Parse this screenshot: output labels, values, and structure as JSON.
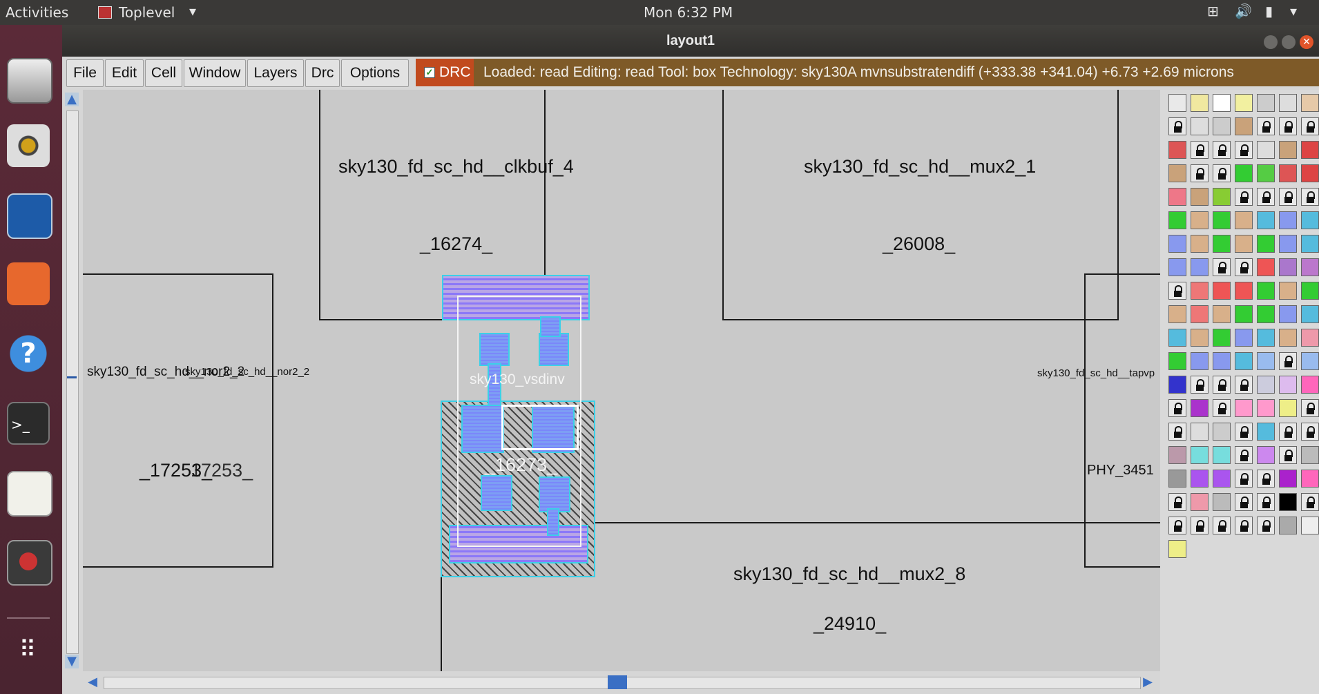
{
  "topbar": {
    "activities": "Activities",
    "app": "Toplevel",
    "clock": "Mon  6:32 PM"
  },
  "window": {
    "title": "layout1"
  },
  "menu": {
    "file": "File",
    "edit": "Edit",
    "cell": "Cell",
    "window": "Window",
    "layers": "Layers",
    "drc_menu": "Drc",
    "options": "Options",
    "drc_toggle": "DRC",
    "status": "Loaded: read  Editing: read  Tool: box   Technology: sky130A    mvnsubstratendiff    (+333.38 +341.04) +6.73 +2.69 microns"
  },
  "cells": {
    "clkbuf_name": "sky130_fd_sc_hd__clkbuf_4",
    "clkbuf_id": "_16274_",
    "mux21_name": "sky130_fd_sc_hd__mux2_1",
    "mux21_id": "_26008_",
    "nor_name": "sky130_fd_sc_hd__nor2_2",
    "nor_name_overlap": "sky130_fd_sc_hd__nor2_2",
    "nor_id": "_17253_",
    "nor_id_overlap": "17253_",
    "vsdinv_name": "sky130_vsdinv",
    "vsdinv_id": "_16273_",
    "tap_name": "sky130_fd_sc_hd__tapvp",
    "tap_id": "PHY_3451",
    "mux28_name": "sky130_fd_sc_hd__mux2_8",
    "mux28_id": "_24910_"
  },
  "colors": {
    "status_bg": "#7e5a28",
    "drc_bg": "#c14a1e",
    "canvas_bg": "#c9c9c9"
  }
}
